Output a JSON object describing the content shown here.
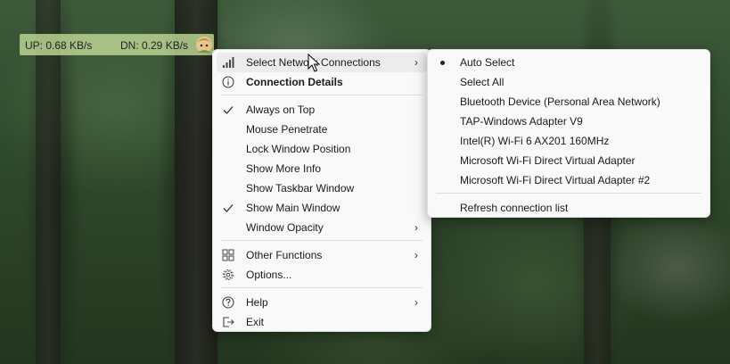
{
  "widget": {
    "upload": "UP: 0.68 KB/s",
    "download": "DN: 0.29 KB/s"
  },
  "main_menu": {
    "select_network": "Select Network Connections",
    "connection_details": "Connection Details",
    "always_on_top": "Always on Top",
    "mouse_penetrate": "Mouse Penetrate",
    "lock_window_position": "Lock Window Position",
    "show_more_info": "Show More Info",
    "show_taskbar_window": "Show Taskbar Window",
    "show_main_window": "Show Main Window",
    "window_opacity": "Window Opacity",
    "other_functions": "Other Functions",
    "options": "Options...",
    "help": "Help",
    "exit": "Exit",
    "checked": [
      "Always on Top",
      "Show Main Window"
    ]
  },
  "sub_menu": {
    "auto_select": "Auto Select",
    "select_all": "Select All",
    "bluetooth": "Bluetooth Device (Personal Area Network)",
    "tap": "TAP-Windows Adapter V9",
    "intel_wifi": "Intel(R) Wi-Fi 6 AX201 160MHz",
    "ms_wifi_direct": "Microsoft Wi-Fi Direct Virtual Adapter",
    "ms_wifi_direct_2": "Microsoft Wi-Fi Direct Virtual Adapter #2",
    "refresh": "Refresh connection list",
    "selected": "Auto Select"
  },
  "icons": {
    "network": "signal-bars-icon",
    "details": "info-icon",
    "check": "checkmark-icon",
    "other": "grid-icon",
    "options": "gear-icon",
    "help": "question-icon",
    "exit": "exit-icon",
    "submenu_arrow": "chevron-right-icon"
  }
}
